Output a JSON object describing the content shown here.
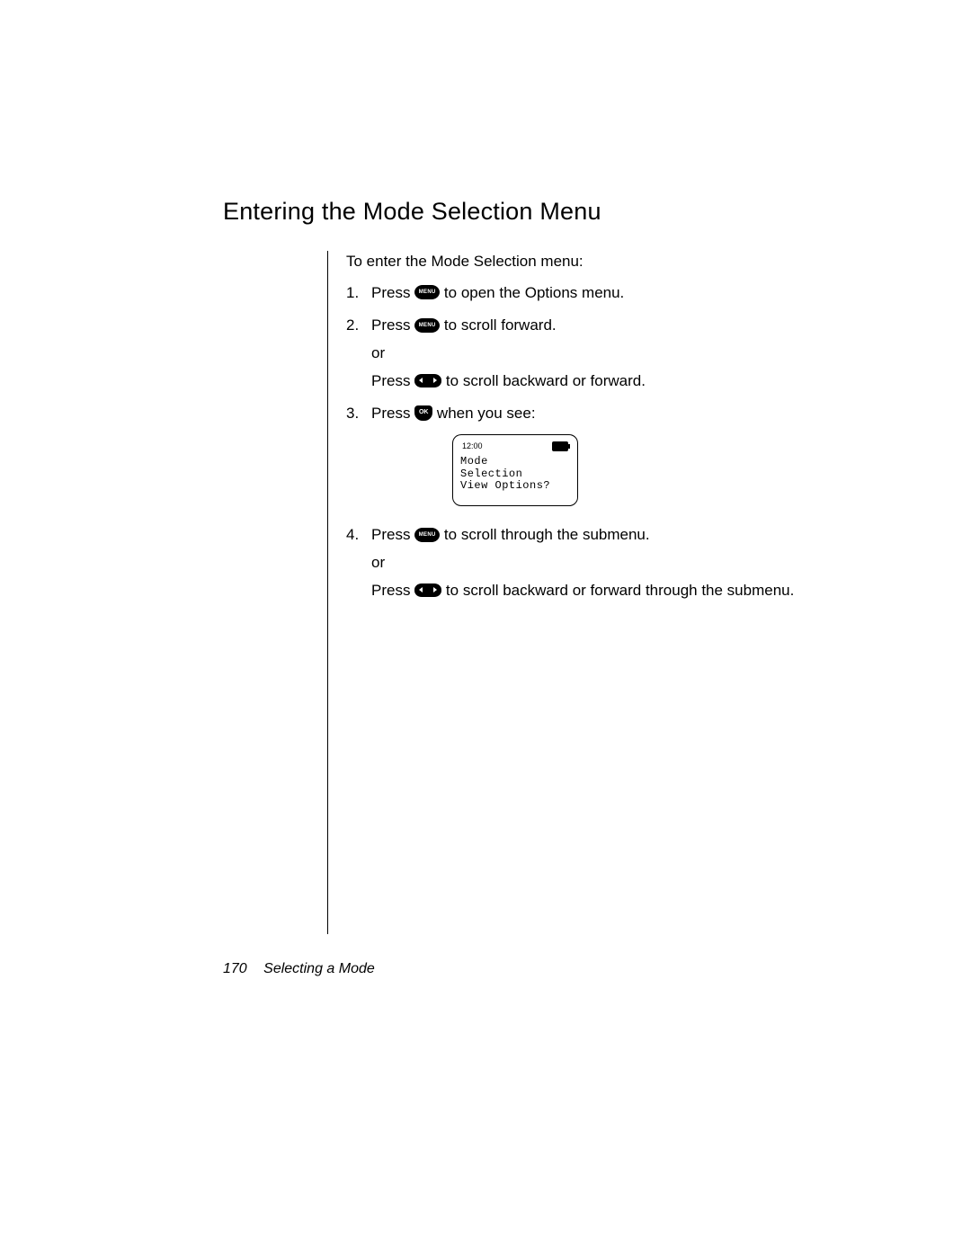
{
  "heading": "Entering the Mode Selection Menu",
  "intro": "To enter the Mode Selection menu:",
  "buttons": {
    "menu_label": "MENU",
    "ok_label": "OK"
  },
  "steps": [
    {
      "num": "1.",
      "line1_a": "Press ",
      "line1_b": " to open the Options menu."
    },
    {
      "num": "2.",
      "line1_a": "Press ",
      "line1_b": " to scroll forward.",
      "or": "or",
      "line2_a": "Press ",
      "line2_b": " to scroll backward or forward."
    },
    {
      "num": "3.",
      "line1_a": "Press ",
      "line1_b": " when you see:"
    },
    {
      "num": "4.",
      "line1_a": "Press ",
      "line1_b": " to scroll through the submenu.",
      "or": "or",
      "line2_a": "Press ",
      "line2_b": " to scroll backward or forward through the submenu."
    }
  ],
  "phone": {
    "time": "12:00",
    "line1": "Mode",
    "line2": "Selection",
    "line3": "View Options?"
  },
  "footer": {
    "page_number": "170",
    "section": "Selecting a Mode"
  }
}
